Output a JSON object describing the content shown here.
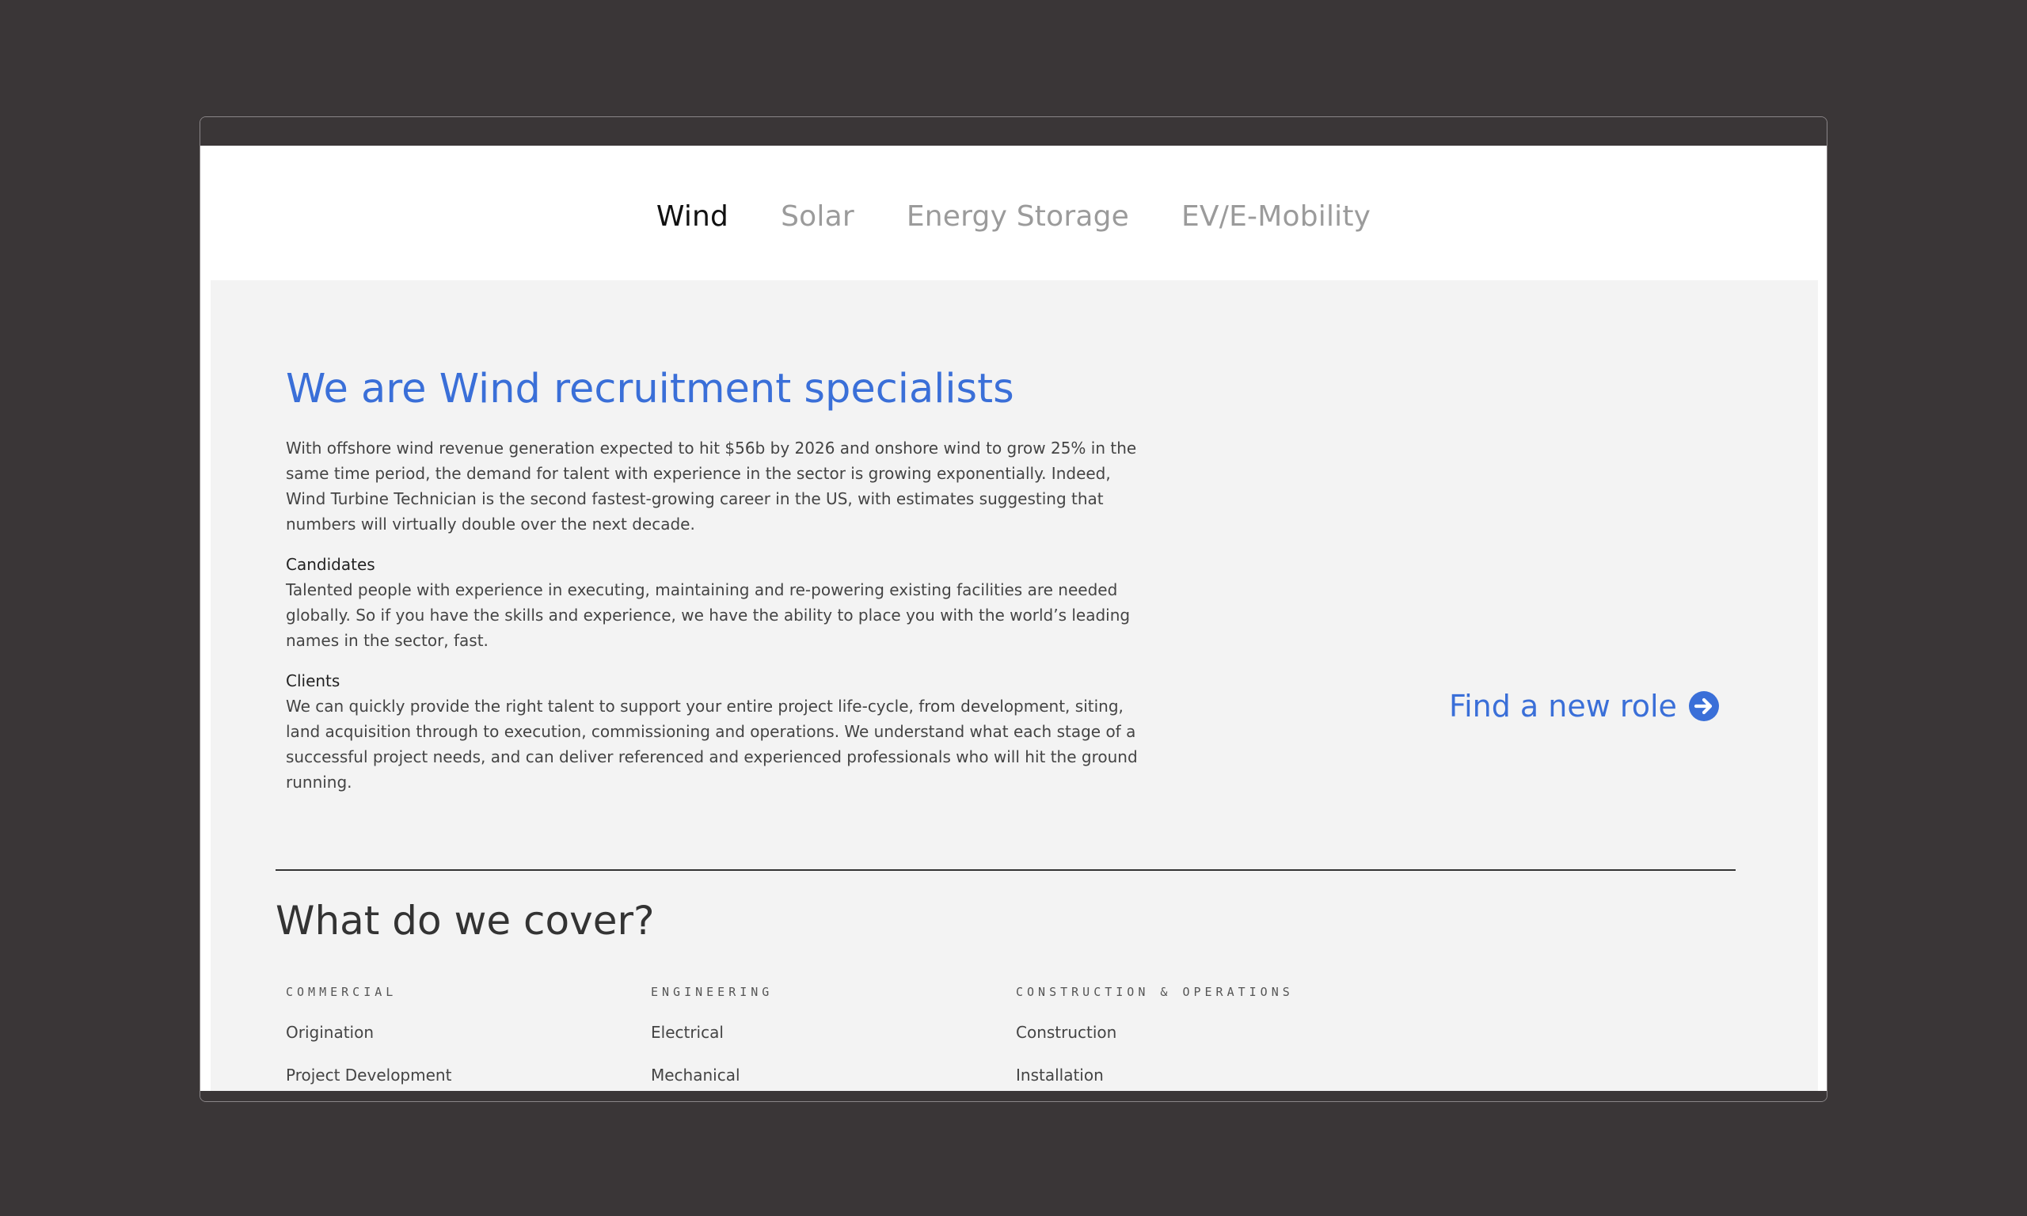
{
  "tabs": [
    {
      "label": "Wind",
      "active": true
    },
    {
      "label": "Solar",
      "active": false
    },
    {
      "label": "Energy Storage",
      "active": false
    },
    {
      "label": "EV/E-Mobility",
      "active": false
    }
  ],
  "hero": {
    "headline": "We are Wind recruitment specialists",
    "intro": "With offshore wind revenue generation expected to hit $56b by 2026 and onshore wind to grow 25% in the same time period, the demand for talent with experience in the sector is growing exponentially. Indeed, Wind Turbine Technician is the second fastest-growing career in the US, with estimates suggesting that numbers will virtually double over the next decade.",
    "candidates_heading": "Candidates",
    "candidates_text": "Talented people with experience in executing, maintaining and re-powering existing facilities are needed globally. So if you have the skills and experience, we have the ability to place you with the world’s leading names in the sector, fast.",
    "clients_heading": "Clients",
    "clients_text": "We can quickly provide the right talent to support your entire project life-cycle, from development, siting, land acquisition through to execution, commissioning and operations. We understand what each stage of a successful project needs, and can deliver referenced and experienced professionals who will hit the ground running.",
    "cta_label": "Find a new role",
    "cta_icon": "arrow-right-circle-icon"
  },
  "cover": {
    "title": "What do we cover?",
    "columns": [
      {
        "header": "COMMERCIAL",
        "items": [
          "Origination",
          "Project Development"
        ]
      },
      {
        "header": "ENGINEERING",
        "items": [
          "Electrical",
          "Mechanical"
        ]
      },
      {
        "header": "CONSTRUCTION & OPERATIONS",
        "items": [
          "Construction",
          "Installation"
        ]
      }
    ]
  },
  "colors": {
    "accent": "#3a6fd8",
    "background": "#3a3637",
    "panel": "#f3f3f3",
    "tab_inactive": "#9b9b9b"
  }
}
